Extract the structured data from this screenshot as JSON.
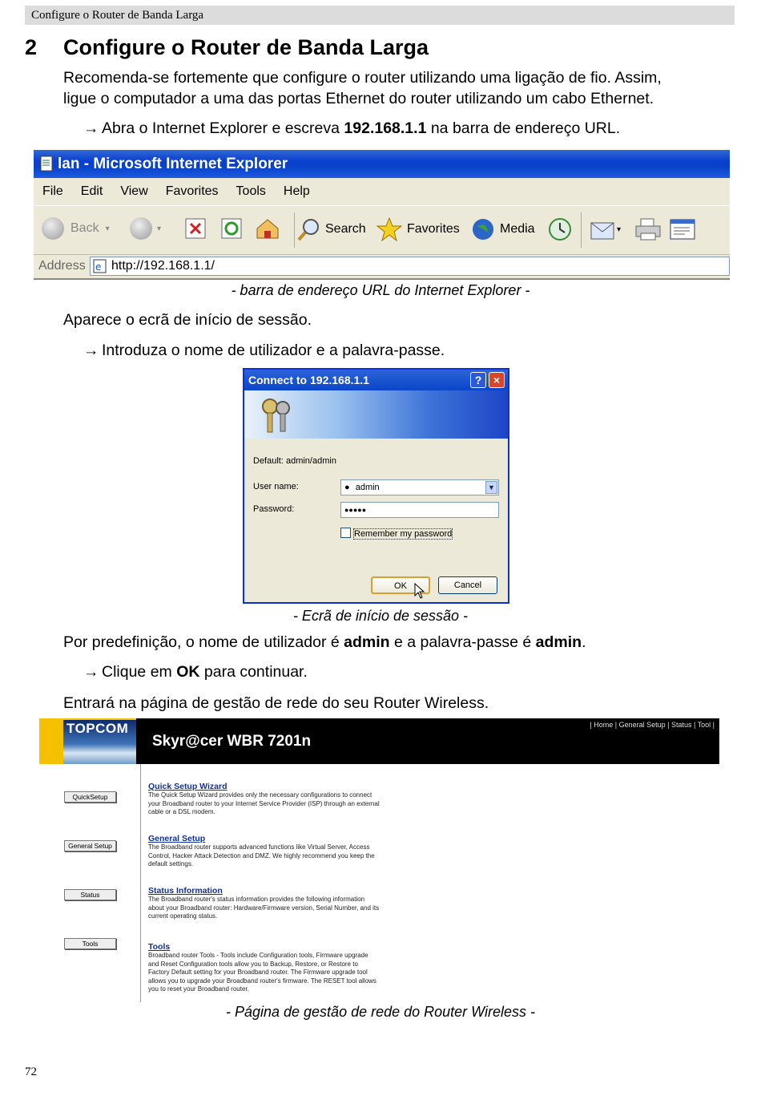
{
  "header": {
    "running_title": "Configure o Router de Banda Larga"
  },
  "section": {
    "number": "2",
    "title": "Configure o Router de Banda Larga"
  },
  "intro": {
    "line1": "Recomenda-se fortemente que configure o router utilizando uma ligação de fio. Assim,",
    "line2": "ligue o computador a uma das portas Ethernet do router utilizando um cabo Ethernet."
  },
  "step1": {
    "arrow": "→",
    "pre": "Abra o Internet Explorer e escreva ",
    "bold": "192.168.1.1",
    "post": " na barra de endereço URL."
  },
  "ie": {
    "title": "lan - Microsoft Internet Explorer",
    "menu": [
      "File",
      "Edit",
      "View",
      "Favorites",
      "Tools",
      "Help"
    ],
    "toolbar": {
      "back": "Back",
      "search": "Search",
      "favorites": "Favorites",
      "media": "Media"
    },
    "address_label": "Address",
    "address_value": "http://192.168.1.1/"
  },
  "caption1": "- barra de endereço URL do Internet Explorer -",
  "login_intro": "Aparece o ecrã de início de sessão.",
  "step2": {
    "arrow": "→",
    "text": "Introduza o nome de utilizador e a palavra-passe."
  },
  "dialog": {
    "title": "Connect to 192.168.1.1",
    "help": "?",
    "close": "×",
    "default_text": "Default: admin/admin",
    "user_label": "User name:",
    "user_value": "admin",
    "password_label": "Password:",
    "password_value": "●●●●●",
    "remember_label": "Remember my password",
    "ok": "OK",
    "cancel": "Cancel"
  },
  "caption2": "- Ecrã de início de sessão -",
  "defaults": {
    "pre": "Por predefinição, o nome de utilizador é ",
    "user": "admin",
    "mid": " e a palavra-passe é ",
    "pass": "admin",
    "post": "."
  },
  "step3": {
    "arrow": "→",
    "pre": "Clique em ",
    "bold": "OK",
    "post": " para continuar."
  },
  "enter_text": "Entrará na página de gestão de rede do seu Router Wireless.",
  "router": {
    "logo": "TOPCOM",
    "product": "Skyr@cer WBR 7201n",
    "nav": "| Home | General Setup | Status | Tool |",
    "side_buttons": [
      "QuickSetup",
      "General Setup",
      "Status",
      "Tools"
    ],
    "sections": [
      {
        "title": "Quick Setup Wizard",
        "desc": "The Quick Setup Wizard provides only the necessary configurations to connect your Broadband router to your Internet Service Provider (ISP) through an external cable or a DSL modem."
      },
      {
        "title": "General Setup",
        "desc": "The Broadband router supports advanced functions like Virtual Server, Access Control, Hacker Attack Detection and DMZ. We highly recommend you keep the default settings."
      },
      {
        "title": "Status Information",
        "desc": "The Broadband router's status information provides the following information about your Broadband router: Hardware/Firmware version, Serial Number, and its current operating status."
      },
      {
        "title": "Tools",
        "desc": "Broadband router Tools - Tools include Configuration tools, Firmware upgrade and Reset Configuration tools allow you to Backup, Restore, or Restore to Factory Default setting for your Broadband router. The Firmware upgrade tool allows you to upgrade your Broadband router's firmware. The RESET tool allows you to reset your Broadband router."
      }
    ]
  },
  "caption3": "- Página de gestão de rede do Router Wireless -",
  "page_number": "72",
  "colors": {
    "xp_title": "#0a3fcf",
    "xp_face": "#ece9d8",
    "router_head": "#000000",
    "topcom_yellow": "#f5c000",
    "link_blue": "#10309a"
  }
}
